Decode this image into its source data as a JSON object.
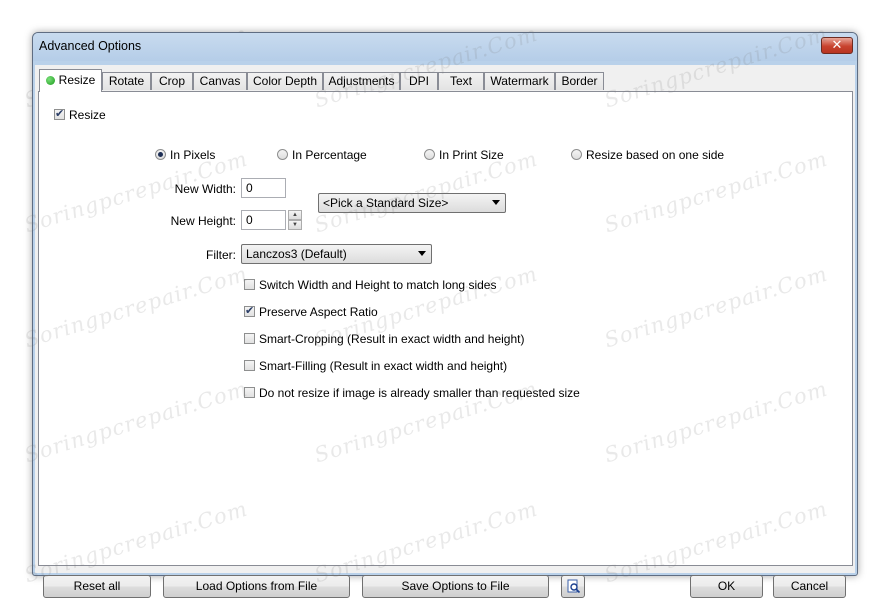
{
  "window": {
    "title": "Advanced Options"
  },
  "tabs": [
    "Resize",
    "Rotate",
    "Crop",
    "Canvas",
    "Color Depth",
    "Adjustments",
    "DPI",
    "Text",
    "Watermark",
    "Border"
  ],
  "resize": {
    "enable_label": "Resize",
    "enable_checked": true,
    "mode_options": [
      {
        "label": "In Pixels",
        "selected": true
      },
      {
        "label": "In Percentage",
        "selected": false
      },
      {
        "label": "In Print Size",
        "selected": false
      },
      {
        "label": "Resize based on one side",
        "selected": false
      }
    ],
    "width_label": "New Width:",
    "width_value": "0",
    "height_label": "New Height:",
    "height_value": "0",
    "standard_size": "<Pick a Standard Size>",
    "filter_label": "Filter:",
    "filter_value": "Lanczos3 (Default)",
    "options": [
      {
        "label": "Switch Width and Height to match long sides",
        "checked": false
      },
      {
        "label": "Preserve Aspect Ratio",
        "checked": true
      },
      {
        "label": "Smart-Cropping (Result in exact width and height)",
        "checked": false
      },
      {
        "label": "Smart-Filling (Result in exact width and height)",
        "checked": false
      },
      {
        "label": "Do not resize if image is already smaller than requested size",
        "checked": false
      }
    ]
  },
  "buttons": {
    "reset": "Reset all",
    "load": "Load Options from File",
    "save": "Save Options to File",
    "ok": "OK",
    "cancel": "Cancel"
  },
  "watermark_text": "Soringpcrepair.Com",
  "colors": {
    "accent": "#1c9a1c",
    "frame": "#b9d1ea",
    "close": "#c8432f"
  }
}
